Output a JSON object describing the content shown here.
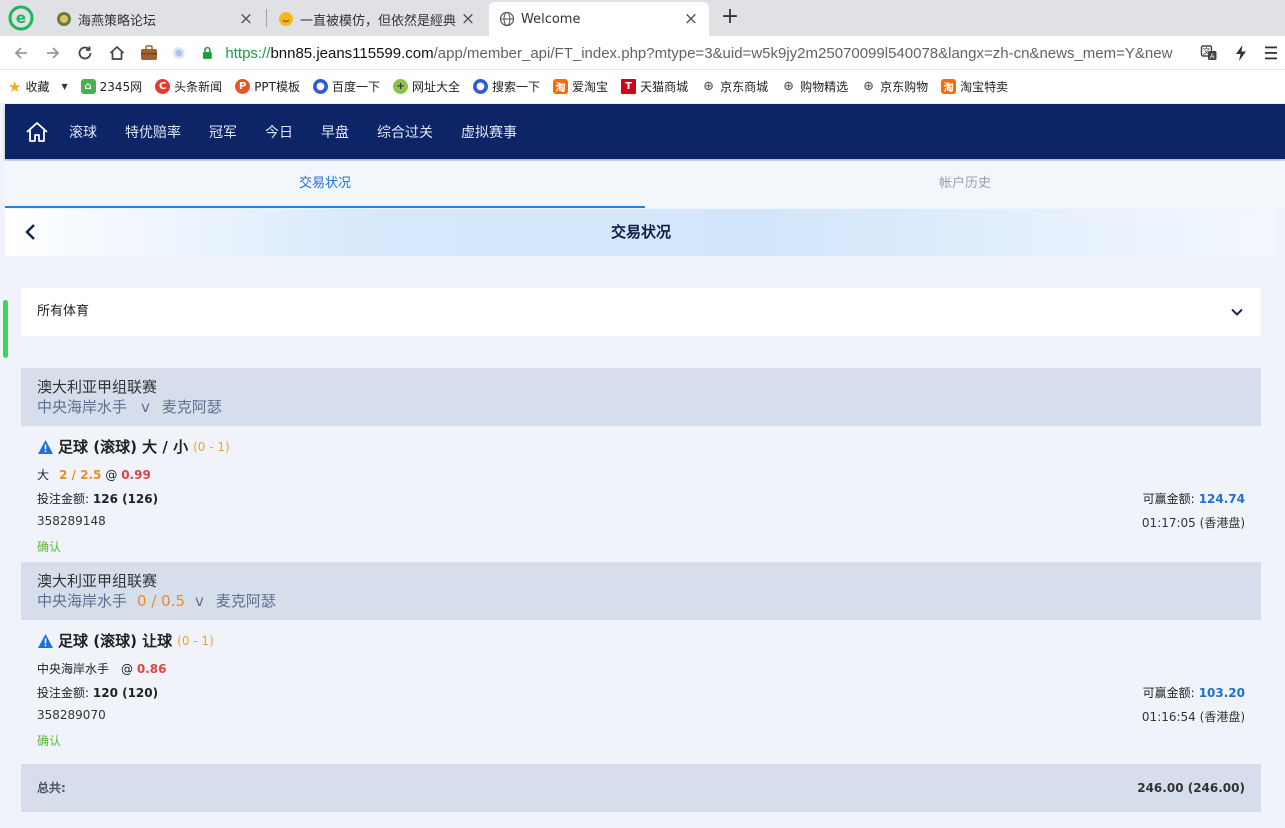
{
  "browser": {
    "tabs": [
      {
        "label": "海燕策略论坛"
      },
      {
        "label": "一直被模仿，但依然是經典"
      },
      {
        "label": "Welcome"
      }
    ],
    "url": {
      "scheme": "https://",
      "host": "bnn85.jeans115599.com",
      "path": "/app/member_api/FT_index.php?mtype=3&uid=w5k9jy2m25070099l540078&langx=zh-cn&news_mem=Y&new"
    },
    "bookmarks": [
      {
        "label": "收藏",
        "icon": "star-icon",
        "color": "#f5a623"
      },
      {
        "label": "2345网",
        "icon": "2345-icon",
        "color": "#4caf50"
      },
      {
        "label": "头条新闻",
        "icon": "toutiao-icon",
        "color": "#e53935"
      },
      {
        "label": "PPT模板",
        "icon": "ppt-icon",
        "color": "#e8572a"
      },
      {
        "label": "百度一下",
        "icon": "baidu-paw-icon",
        "color": "#2e5bd8"
      },
      {
        "label": "网址大全",
        "icon": "compass-icon",
        "color": "#8bc34a"
      },
      {
        "label": "搜索一下",
        "icon": "baidu-paw-icon",
        "color": "#2e5bd8"
      },
      {
        "label": "爱淘宝",
        "icon": "taobao-icon",
        "color": "#ff6a00"
      },
      {
        "label": "天猫商城",
        "icon": "tmall-icon",
        "color": "#d0021b"
      },
      {
        "label": "京东商城",
        "icon": "globe-icon",
        "color": "#666666"
      },
      {
        "label": "购物精选",
        "icon": "globe-icon",
        "color": "#666666"
      },
      {
        "label": "京东购物",
        "icon": "globe-icon",
        "color": "#666666"
      },
      {
        "label": "淘宝特卖",
        "icon": "taobao-icon",
        "color": "#ff6a00"
      }
    ]
  },
  "nav": {
    "items": [
      "滚球",
      "特优赔率",
      "冠军",
      "今日",
      "早盘",
      "综合过关",
      "虚拟赛事"
    ]
  },
  "subtabs": [
    {
      "label": "交易状况",
      "active": true
    },
    {
      "label": "帐户历史",
      "active": false
    }
  ],
  "page_title": "交易状况",
  "filter": {
    "label": "所有体育"
  },
  "bets": [
    {
      "league": "澳大利亚甲组联赛",
      "home": "中央海岸水手",
      "handicap": "",
      "vs": "v",
      "away": "麦克阿瑟",
      "market": "足球 (滚球) 大 / 小",
      "score": "(0 - 1)",
      "selection": "大",
      "line": "2 / 2.5",
      "at": "@",
      "odds": "0.99",
      "stake_label": "投注金额:",
      "stake": "126 (126)",
      "win_label": "可赢金额:",
      "win": "124.74",
      "ticket": "358289148",
      "time": "01:17:05 (香港盘)",
      "status": "确认"
    },
    {
      "league": "澳大利亚甲组联赛",
      "home": "中央海岸水手",
      "handicap": "0 / 0.5",
      "vs": "v",
      "away": "麦克阿瑟",
      "market": "足球 (滚球) 让球",
      "score": "(0 - 1)",
      "selection": "中央海岸水手",
      "line": "",
      "at": "@",
      "odds": "0.86",
      "stake_label": "投注金额:",
      "stake": "120 (120)",
      "win_label": "可赢金额:",
      "win": "103.20",
      "ticket": "358289070",
      "time": "01:16:54 (香港盘)",
      "status": "确认"
    }
  ],
  "total": {
    "label": "总共:",
    "value": "246.00 (246.00)"
  },
  "colors": {
    "nav_bg": "#0d2467",
    "accent_blue": "#1f6fd6",
    "odds_red": "#e0443c",
    "line_orange": "#f08a24",
    "status_green": "#59b83a"
  }
}
